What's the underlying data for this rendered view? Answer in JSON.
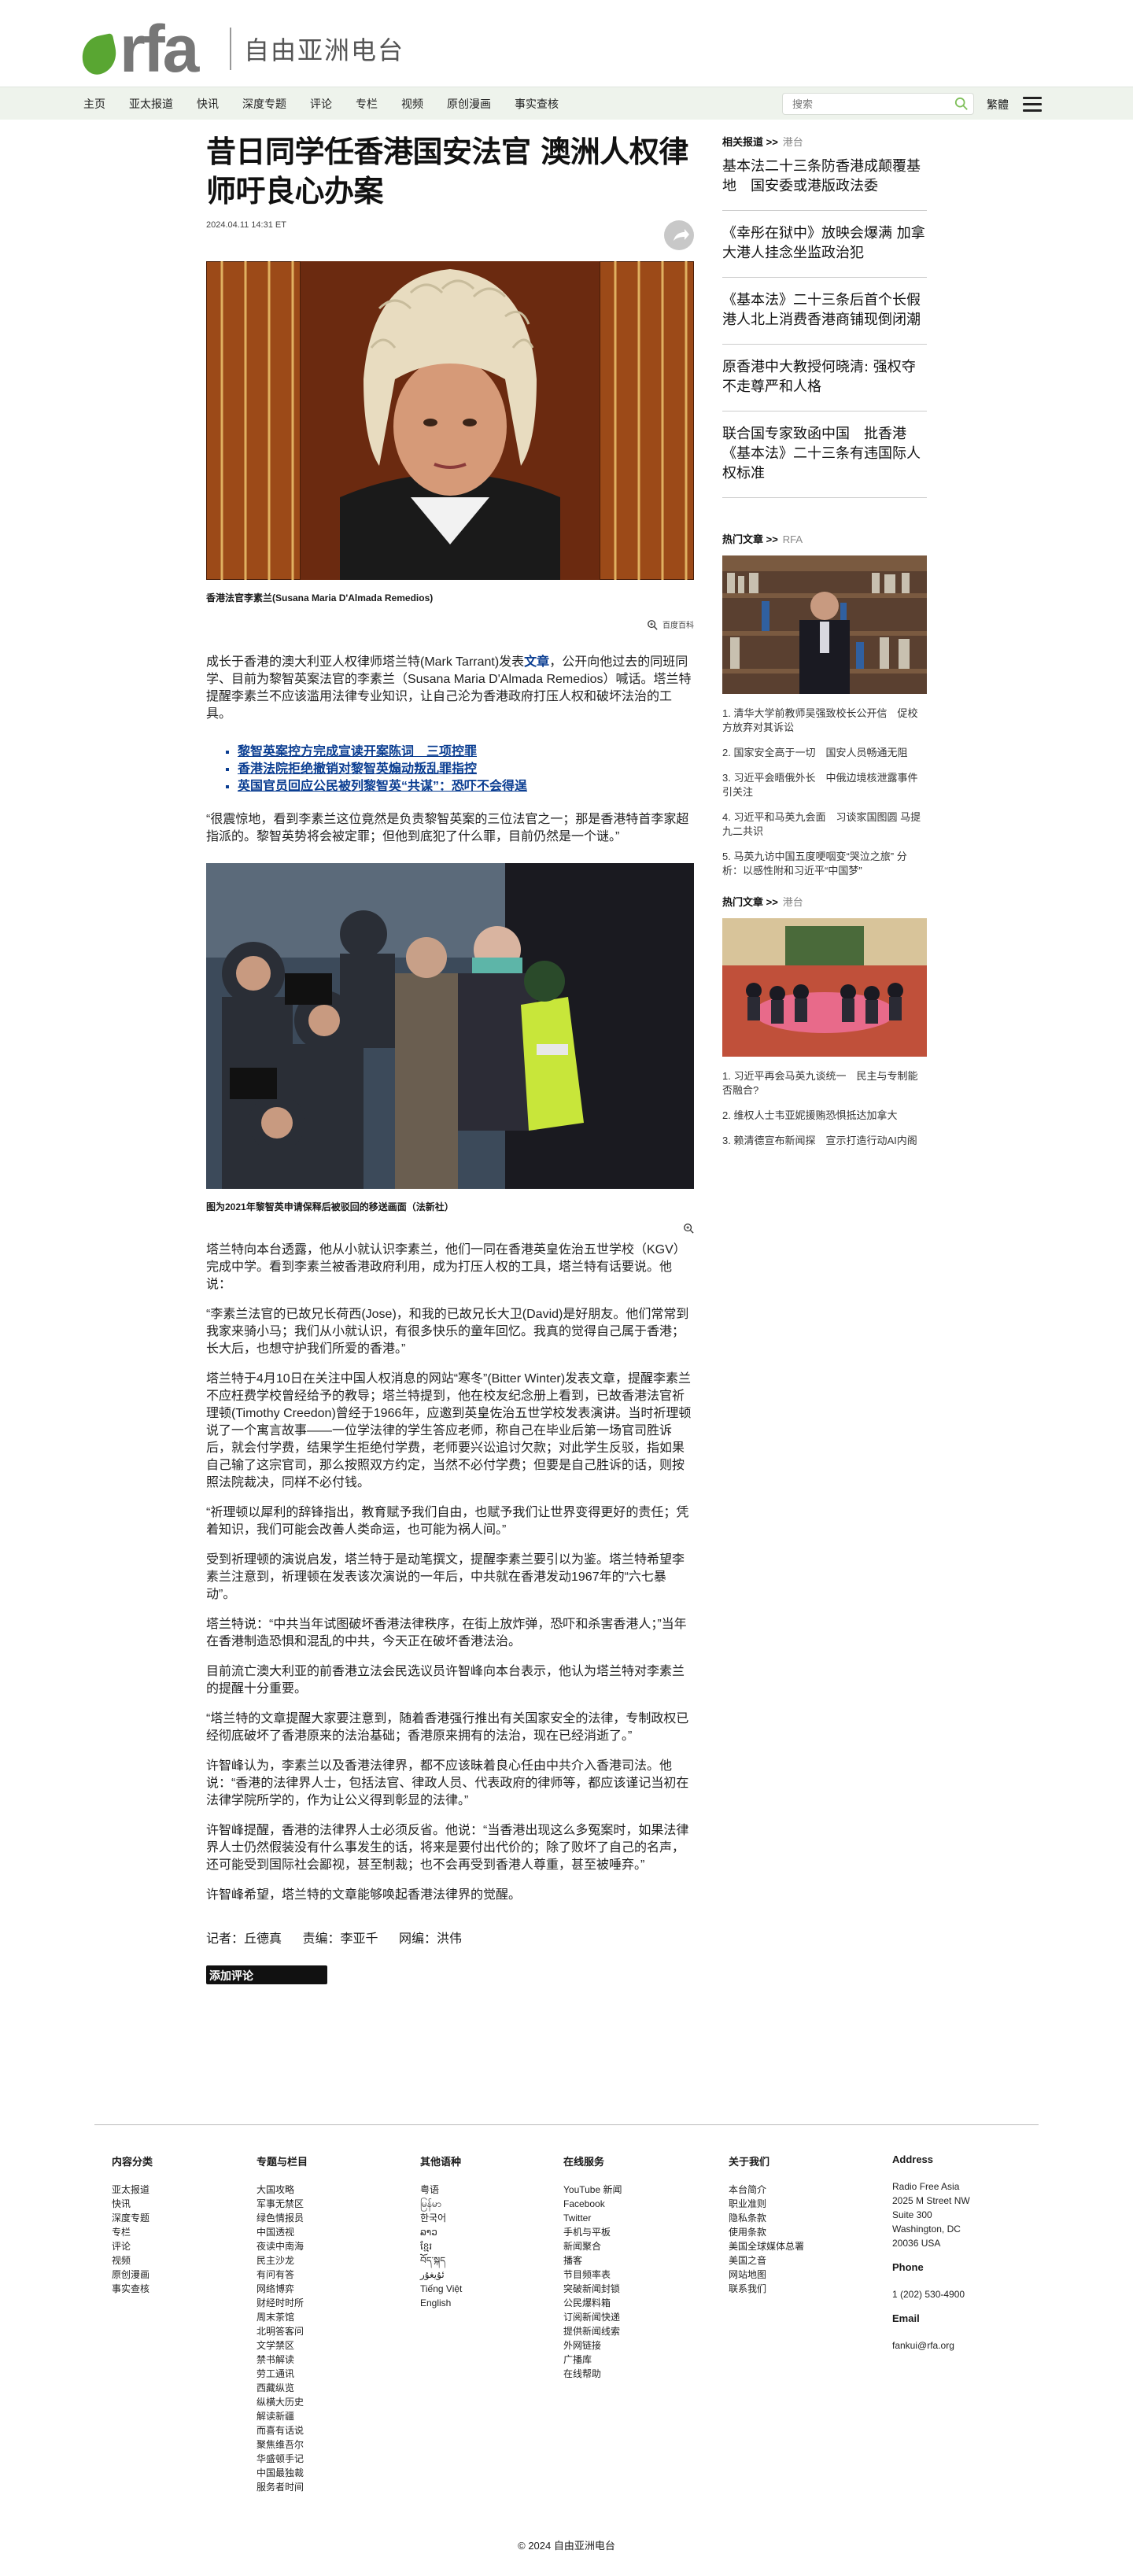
{
  "header": {
    "logo_text": "rfa",
    "logo_cn": "自由亚洲电台"
  },
  "nav": {
    "items": [
      "主页",
      "亚太报道",
      "快讯",
      "深度专题",
      "评论",
      "专栏",
      "视频",
      "原创漫画",
      "事实查核"
    ],
    "search_placeholder": "搜索",
    "lang_label": "繁體"
  },
  "article": {
    "title": "昔日同学任香港国安法官 澳洲人权律师吁良心办案",
    "date": "2024.04.11 14:31 ET",
    "hero_caption": "香港法官李素兰(Susana Maria D'Almada Remedios)",
    "hero_credit": "百度百科",
    "p1_a": "成长于香港的澳大利亚人权律师塔兰特(Mark Tarrant)发表",
    "p1_link": "文章",
    "p1_b": "，公开向他过去的同班同学、目前为黎智英案法官的李素兰（Susana Maria D'Almada Remedios）喊话。塔兰特提醒李素兰不应该滥用法律专业知识，让自己沦为香港政府打压人权和破坏法治的工具。",
    "related": [
      "黎智英案控方完成宣读开案陈词　三项控罪",
      "香港法院拒绝撤销对黎智英煽动叛乱罪指控",
      "英国官员回应公民被列黎智英“共谋”：恐吓不会得逞"
    ],
    "p2": "“很震惊地，看到李素兰这位竟然是负责黎智英案的三位法官之一；那是香港特首李家超指派的。黎智英势将会被定罪；但他到底犯了什么罪，目前仍然是一个谜。”",
    "photo2_caption": "图为2021年黎智英申请保释后被驳回的移送画面（法新社）",
    "p3": "塔兰特向本台透露，他从小就认识李素兰，他们一同在香港英皇佐治五世学校（KGV）完成中学。看到李素兰被香港政府利用，成为打压人权的工具，塔兰特有话要说。他说：",
    "p4": "“李素兰法官的已故兄长荷西(Jose)，和我的已故兄长大卫(David)是好朋友。他们常常到我家来骑小马；我们从小就认识，有很多快乐的童年回忆。我真的觉得自己属于香港；长大后，也想守护我们所爱的香港。”",
    "p5": "塔兰特于4月10日在关注中国人权消息的网站“寒冬”(Bitter Winter)发表文章，提醒李素兰不应枉费学校曾经给予的教导；塔兰特提到，他在校友纪念册上看到，已故香港法官祈理顿(Timothy Creedon)曾经于1966年，应邀到英皇佐治五世学校发表演讲。当时祈理顿说了一个寓言故事——一位学法律的学生答应老师，称自己在毕业后第一场官司胜诉后，就会付学费，结果学生拒绝付学费，老师要兴讼追讨欠款；对此学生反驳，指如果自己输了这宗官司，那么按照双方约定，当然不必付学费；但要是自己胜诉的话，则按照法院裁决，同样不必付钱。",
    "p6": "“祈理顿以犀利的辞锋指出，教育赋予我们自由，也赋予我们让世界变得更好的责任；凭着知识，我们可能会改善人类命运，也可能为祸人间。”",
    "p7": "受到祈理顿的演说启发，塔兰特于是动笔撰文，提醒李素兰要引以为鉴。塔兰特希望李素兰注意到，祈理顿在发表该次演说的一年后，中共就在香港发动1967年的“六七暴动”。",
    "p8": "塔兰特说：“中共当年试图破坏香港法律秩序，在街上放炸弹，恐吓和杀害香港人；”当年在香港制造恐惧和混乱的中共，今天正在破坏香港法治。",
    "p9": "目前流亡澳大利亚的前香港立法会民选议员许智峰向本台表示，他认为塔兰特对李素兰的提醒十分重要。",
    "p10": "“塔兰特的文章提醒大家要注意到，随着香港强行推出有关国家安全的法律，专制政权已经彻底破坏了香港原来的法治基础；香港原来拥有的法治，现在已经消逝了。”",
    "p11": "许智峰认为，李素兰以及香港法律界，都不应该昧着良心任由中共介入香港司法。他说：“香港的法律界人士，包括法官、律政人员、代表政府的律师等，都应该谨记当初在法律学院所学的，作为让公义得到彰显的法律。”",
    "p12": "许智峰提醒，香港的法律界人士必须反省。他说：“当香港出现这么多冤案时，如果法律界人士仍然假装没有什么事发生的话，将来是要付出代价的；除了败坏了自己的名声，还可能受到国际社会鄙视，甚至制裁；也不会再受到香港人尊重，甚至被唾弃。”",
    "p13": "许智峰希望，塔兰特的文章能够唤起香港法律界的觉醒。",
    "reporter": "记者：丘德真",
    "editor": "责编：李亚千",
    "web_editor": "网编：洪伟",
    "comment_button": "添加评论"
  },
  "sidebar": {
    "related_head": "相关报道 >>",
    "related_sub": "港台",
    "related_links": [
      "基本法二十三条防香港成颠覆基地　国安委或港版政法委",
      "《幸彤在狱中》放映会爆满 加拿大港人挂念坐监政治犯",
      "《基本法》二十三条后首个长假　港人北上消费香港商铺现倒闭潮",
      "原香港中大教授何晓清: 强权夺不走尊严和人格",
      "联合国专家致函中国　批香港《基本法》二十三条有违国际人权标准"
    ],
    "hot1_head": "热门文章 >>",
    "hot1_sub": "RFA",
    "hot1_items": [
      "1. 清华大学前教师吴强致校长公开信　促校方放弃对其诉讼",
      "2. 国家安全高于一切　国安人员畅通无阻",
      "3. 习近平会晤俄外长　中俄边境核泄露事件引关注",
      "4. 习近平和马英九会面　习谈家国图圆 马提九二共识",
      "5. 马英九访中国五度哽咽变“哭泣之旅” 分析：以感性附和习近平“中国梦”"
    ],
    "hot2_head": "热门文章 >>",
    "hot2_sub": "港台",
    "hot2_items": [
      "1. 习近平再会马英九谈统一　民主与专制能否融合?",
      "2. 维权人士韦亚妮援贿恐惧抵达加拿大",
      "3. 赖清德宣布新闻探　宣示打造行动AI内阁"
    ]
  },
  "footer": {
    "col1_head": "内容分类",
    "col1": [
      "亚太报道",
      "快讯",
      "深度专题",
      "专栏",
      "评论",
      "视频",
      "原创漫画",
      "事实查核"
    ],
    "col2_head": "专题与栏目",
    "col2": [
      "大国攻略",
      "军事无禁区",
      "绿色情报员",
      "中国透视",
      "夜读中南海",
      "民主沙龙",
      "有问有答",
      "网络博弈",
      "财经时时所",
      "周末茶馆",
      "北明答客问",
      "文学禁区",
      "禁书解读",
      "劳工通讯",
      "西藏纵览",
      "纵横大历史",
      "解读新疆",
      "而喜有话说",
      "聚焦维吾尔",
      "华盛顿手记",
      "中国最独裁",
      "服务者时间"
    ],
    "col3_head": "其他语种",
    "col3": [
      "粤语",
      "မြန်မာ",
      "한국어",
      "ລາວ",
      "ខ្មែរ",
      "བོད་སྐད",
      "ئۇيغۇر",
      "Tiếng Việt",
      "English"
    ],
    "col4_head": "在线服务",
    "col4": [
      "YouTube 新闻",
      "Facebook",
      "Twitter",
      "手机与平板",
      "新闻聚合",
      "播客",
      "节目频率表",
      "突破新闻封锁",
      "公民爆料箱",
      "订阅新闻快递",
      "提供新闻线索",
      "外网链接",
      "广播库",
      "在线帮助"
    ],
    "col5_head": "关于我们",
    "col5": [
      "本台简介",
      "职业准则",
      "隐私条款",
      "使用条款",
      "美国全球媒体总署",
      "美国之音",
      "网站地图",
      "联系我们"
    ],
    "col6_head": "Address",
    "address": [
      "Radio Free Asia",
      "2025 M Street NW",
      "Suite 300",
      "Washington, DC",
      "20036 USA"
    ],
    "phone_head": "Phone",
    "phone": "1 (202) 530-4900",
    "email_head": "Email",
    "email": "fankui@rfa.org",
    "copyright": "© 2024 自由亚洲电台"
  }
}
